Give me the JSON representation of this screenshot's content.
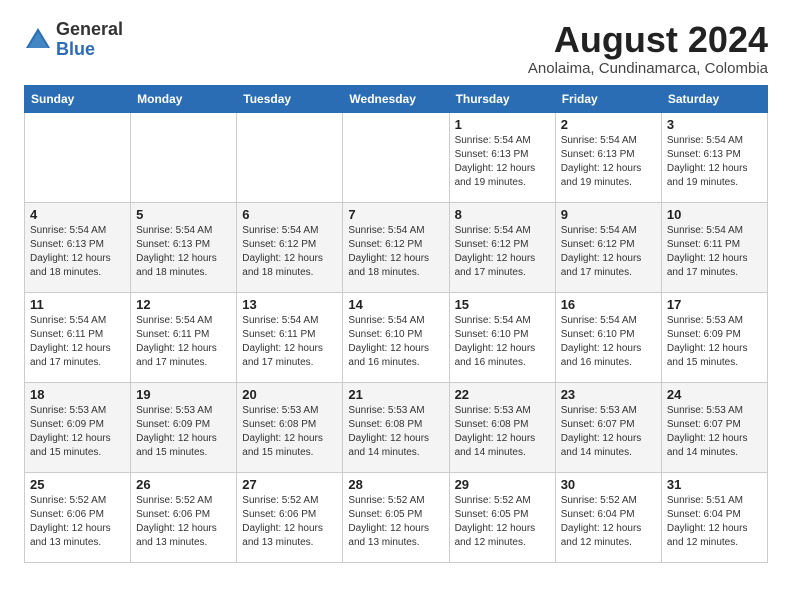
{
  "header": {
    "logo_general": "General",
    "logo_blue": "Blue",
    "month_year": "August 2024",
    "location": "Anolaima, Cundinamarca, Colombia"
  },
  "weekdays": [
    "Sunday",
    "Monday",
    "Tuesday",
    "Wednesday",
    "Thursday",
    "Friday",
    "Saturday"
  ],
  "weeks": [
    [
      {
        "day": "",
        "content": ""
      },
      {
        "day": "",
        "content": ""
      },
      {
        "day": "",
        "content": ""
      },
      {
        "day": "",
        "content": ""
      },
      {
        "day": "1",
        "content": "Sunrise: 5:54 AM\nSunset: 6:13 PM\nDaylight: 12 hours\nand 19 minutes."
      },
      {
        "day": "2",
        "content": "Sunrise: 5:54 AM\nSunset: 6:13 PM\nDaylight: 12 hours\nand 19 minutes."
      },
      {
        "day": "3",
        "content": "Sunrise: 5:54 AM\nSunset: 6:13 PM\nDaylight: 12 hours\nand 19 minutes."
      }
    ],
    [
      {
        "day": "4",
        "content": "Sunrise: 5:54 AM\nSunset: 6:13 PM\nDaylight: 12 hours\nand 18 minutes."
      },
      {
        "day": "5",
        "content": "Sunrise: 5:54 AM\nSunset: 6:13 PM\nDaylight: 12 hours\nand 18 minutes."
      },
      {
        "day": "6",
        "content": "Sunrise: 5:54 AM\nSunset: 6:12 PM\nDaylight: 12 hours\nand 18 minutes."
      },
      {
        "day": "7",
        "content": "Sunrise: 5:54 AM\nSunset: 6:12 PM\nDaylight: 12 hours\nand 18 minutes."
      },
      {
        "day": "8",
        "content": "Sunrise: 5:54 AM\nSunset: 6:12 PM\nDaylight: 12 hours\nand 17 minutes."
      },
      {
        "day": "9",
        "content": "Sunrise: 5:54 AM\nSunset: 6:12 PM\nDaylight: 12 hours\nand 17 minutes."
      },
      {
        "day": "10",
        "content": "Sunrise: 5:54 AM\nSunset: 6:11 PM\nDaylight: 12 hours\nand 17 minutes."
      }
    ],
    [
      {
        "day": "11",
        "content": "Sunrise: 5:54 AM\nSunset: 6:11 PM\nDaylight: 12 hours\nand 17 minutes."
      },
      {
        "day": "12",
        "content": "Sunrise: 5:54 AM\nSunset: 6:11 PM\nDaylight: 12 hours\nand 17 minutes."
      },
      {
        "day": "13",
        "content": "Sunrise: 5:54 AM\nSunset: 6:11 PM\nDaylight: 12 hours\nand 17 minutes."
      },
      {
        "day": "14",
        "content": "Sunrise: 5:54 AM\nSunset: 6:10 PM\nDaylight: 12 hours\nand 16 minutes."
      },
      {
        "day": "15",
        "content": "Sunrise: 5:54 AM\nSunset: 6:10 PM\nDaylight: 12 hours\nand 16 minutes."
      },
      {
        "day": "16",
        "content": "Sunrise: 5:54 AM\nSunset: 6:10 PM\nDaylight: 12 hours\nand 16 minutes."
      },
      {
        "day": "17",
        "content": "Sunrise: 5:53 AM\nSunset: 6:09 PM\nDaylight: 12 hours\nand 15 minutes."
      }
    ],
    [
      {
        "day": "18",
        "content": "Sunrise: 5:53 AM\nSunset: 6:09 PM\nDaylight: 12 hours\nand 15 minutes."
      },
      {
        "day": "19",
        "content": "Sunrise: 5:53 AM\nSunset: 6:09 PM\nDaylight: 12 hours\nand 15 minutes."
      },
      {
        "day": "20",
        "content": "Sunrise: 5:53 AM\nSunset: 6:08 PM\nDaylight: 12 hours\nand 15 minutes."
      },
      {
        "day": "21",
        "content": "Sunrise: 5:53 AM\nSunset: 6:08 PM\nDaylight: 12 hours\nand 14 minutes."
      },
      {
        "day": "22",
        "content": "Sunrise: 5:53 AM\nSunset: 6:08 PM\nDaylight: 12 hours\nand 14 minutes."
      },
      {
        "day": "23",
        "content": "Sunrise: 5:53 AM\nSunset: 6:07 PM\nDaylight: 12 hours\nand 14 minutes."
      },
      {
        "day": "24",
        "content": "Sunrise: 5:53 AM\nSunset: 6:07 PM\nDaylight: 12 hours\nand 14 minutes."
      }
    ],
    [
      {
        "day": "25",
        "content": "Sunrise: 5:52 AM\nSunset: 6:06 PM\nDaylight: 12 hours\nand 13 minutes."
      },
      {
        "day": "26",
        "content": "Sunrise: 5:52 AM\nSunset: 6:06 PM\nDaylight: 12 hours\nand 13 minutes."
      },
      {
        "day": "27",
        "content": "Sunrise: 5:52 AM\nSunset: 6:06 PM\nDaylight: 12 hours\nand 13 minutes."
      },
      {
        "day": "28",
        "content": "Sunrise: 5:52 AM\nSunset: 6:05 PM\nDaylight: 12 hours\nand 13 minutes."
      },
      {
        "day": "29",
        "content": "Sunrise: 5:52 AM\nSunset: 6:05 PM\nDaylight: 12 hours\nand 12 minutes."
      },
      {
        "day": "30",
        "content": "Sunrise: 5:52 AM\nSunset: 6:04 PM\nDaylight: 12 hours\nand 12 minutes."
      },
      {
        "day": "31",
        "content": "Sunrise: 5:51 AM\nSunset: 6:04 PM\nDaylight: 12 hours\nand 12 minutes."
      }
    ]
  ]
}
